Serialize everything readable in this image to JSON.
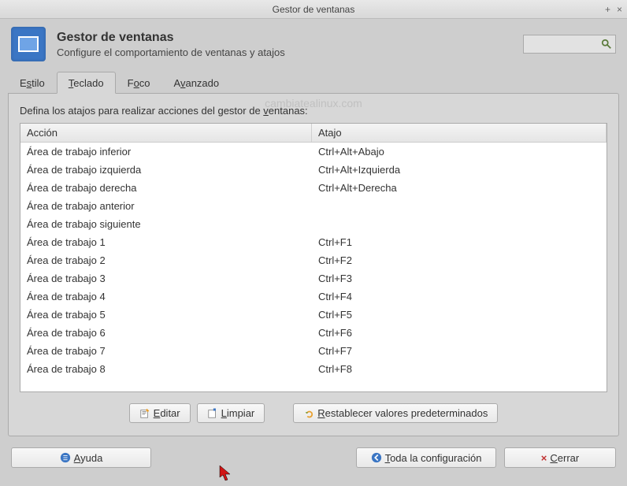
{
  "window": {
    "title": "Gestor de ventanas"
  },
  "header": {
    "title": "Gestor de ventanas",
    "subtitle": "Configure el comportamiento de ventanas y atajos"
  },
  "watermark": "cambiatealinux.com",
  "tabs": {
    "estilo_pre": "E",
    "estilo_u": "s",
    "estilo_post": "tilo",
    "teclado_pre": "",
    "teclado_u": "T",
    "teclado_post": "eclado",
    "foco_pre": "F",
    "foco_u": "o",
    "foco_post": "co",
    "avanzado_pre": "A",
    "avanzado_u": "v",
    "avanzado_post": "anzado"
  },
  "instruction_pre": "Defina los atajos para realizar acciones del gestor de ",
  "instruction_u": "v",
  "instruction_post": "entanas:",
  "columns": {
    "action": "Acción",
    "shortcut": "Atajo"
  },
  "rows": [
    {
      "action": "Área de trabajo inferior",
      "shortcut": "Ctrl+Alt+Abajo"
    },
    {
      "action": "Área de trabajo izquierda",
      "shortcut": "Ctrl+Alt+Izquierda"
    },
    {
      "action": "Área de trabajo derecha",
      "shortcut": "Ctrl+Alt+Derecha"
    },
    {
      "action": "Área de trabajo anterior",
      "shortcut": ""
    },
    {
      "action": "Área de trabajo siguiente",
      "shortcut": ""
    },
    {
      "action": "Área de trabajo 1",
      "shortcut": "Ctrl+F1"
    },
    {
      "action": "Área de trabajo 2",
      "shortcut": "Ctrl+F2"
    },
    {
      "action": "Área de trabajo 3",
      "shortcut": "Ctrl+F3"
    },
    {
      "action": "Área de trabajo 4",
      "shortcut": "Ctrl+F4"
    },
    {
      "action": "Área de trabajo 5",
      "shortcut": "Ctrl+F5"
    },
    {
      "action": "Área de trabajo 6",
      "shortcut": "Ctrl+F6"
    },
    {
      "action": "Área de trabajo 7",
      "shortcut": "Ctrl+F7"
    },
    {
      "action": "Área de trabajo 8",
      "shortcut": "Ctrl+F8"
    }
  ],
  "buttons": {
    "edit_u": "E",
    "edit_post": "ditar",
    "clear_u": "L",
    "clear_post": "impiar",
    "reset_u": "R",
    "reset_post": "establecer valores predeterminados",
    "help_u": "A",
    "help_post": "yuda",
    "all_u": "T",
    "all_post": "oda la configuración",
    "close_pre": "× ",
    "close_u": "C",
    "close_post": "errar"
  }
}
